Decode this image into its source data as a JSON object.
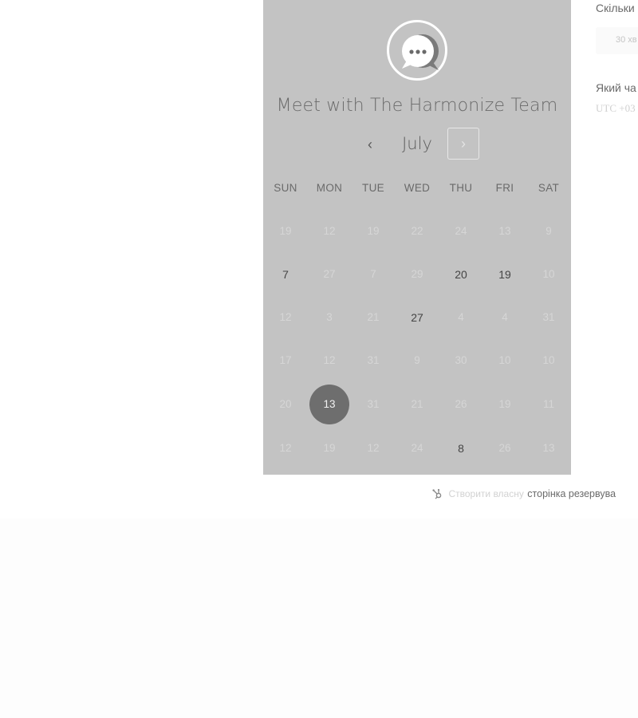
{
  "calendar": {
    "title": "Meet with The Harmonize Team",
    "month": "July",
    "prev_icon": "chevron-left-icon",
    "next_icon": "chevron-right-icon",
    "days_of_week": [
      "SUN",
      "MON",
      "TUE",
      "WED",
      "THU",
      "FRI",
      "SAT"
    ],
    "weeks": [
      [
        {
          "d": "19",
          "s": "dim"
        },
        {
          "d": "12",
          "s": "dim"
        },
        {
          "d": "19",
          "s": "dim"
        },
        {
          "d": "22",
          "s": "dim"
        },
        {
          "d": "24",
          "s": "dim"
        },
        {
          "d": "13",
          "s": "dim"
        },
        {
          "d": "9",
          "s": "dim"
        }
      ],
      [
        {
          "d": "7",
          "s": "active"
        },
        {
          "d": "27",
          "s": "dim"
        },
        {
          "d": "7",
          "s": "dim"
        },
        {
          "d": "29",
          "s": "dim"
        },
        {
          "d": "20",
          "s": "active"
        },
        {
          "d": "19",
          "s": "active"
        },
        {
          "d": "10",
          "s": "dim"
        }
      ],
      [
        {
          "d": "12",
          "s": "dim"
        },
        {
          "d": "3",
          "s": "dim"
        },
        {
          "d": "21",
          "s": "dim"
        },
        {
          "d": "27",
          "s": "active"
        },
        {
          "d": "4",
          "s": "dim"
        },
        {
          "d": "4",
          "s": "dim"
        },
        {
          "d": "31",
          "s": "dim"
        }
      ],
      [
        {
          "d": "17",
          "s": "dim"
        },
        {
          "d": "12",
          "s": "dim"
        },
        {
          "d": "31",
          "s": "dim"
        },
        {
          "d": "9",
          "s": "dim"
        },
        {
          "d": "30",
          "s": "dim"
        },
        {
          "d": "10",
          "s": "dim"
        },
        {
          "d": "10",
          "s": "dim"
        }
      ],
      [
        {
          "d": "20",
          "s": "dim"
        },
        {
          "d": "13",
          "s": "selected"
        },
        {
          "d": "31",
          "s": "dim"
        },
        {
          "d": "21",
          "s": "dim"
        },
        {
          "d": "26",
          "s": "dim"
        },
        {
          "d": "19",
          "s": "dim"
        },
        {
          "d": "11",
          "s": "dim"
        }
      ],
      [
        {
          "d": "12",
          "s": "dim"
        },
        {
          "d": "19",
          "s": "dim"
        },
        {
          "d": "12",
          "s": "dim"
        },
        {
          "d": "24",
          "s": "dim"
        },
        {
          "d": "8",
          "s": "active"
        },
        {
          "d": "26",
          "s": "dim"
        },
        {
          "d": "13",
          "s": "dim"
        }
      ]
    ]
  },
  "booking": {
    "duration_question": "Скільки",
    "duration_value": "30 хв",
    "time_question": "Який ча",
    "timezone": "UTC +03"
  },
  "footer": {
    "icon": "hubspot-sprocket-icon",
    "prefix": "Створити власну",
    "link": "сторінка резервува"
  },
  "colors": {
    "panel": "#c3c3c3",
    "selected_day": "#6e6e6e",
    "text_dark": "#454545"
  }
}
